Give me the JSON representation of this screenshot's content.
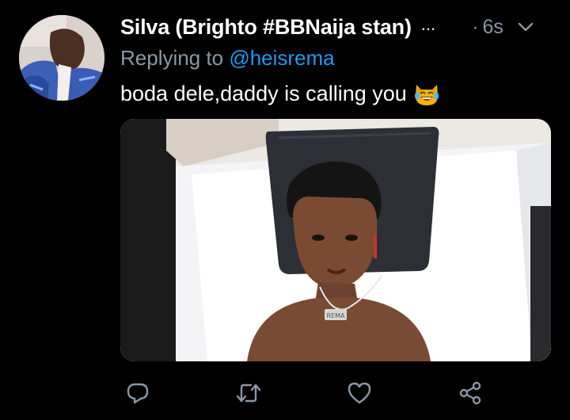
{
  "tweet": {
    "display_name": "Silva (Brighto #BBNaija stan)",
    "overflow_marker": "...",
    "timestamp_dot": "·",
    "timestamp": "6s",
    "reply_prefix": "Replying to",
    "reply_handle": "@heisrema",
    "text": "boda dele,daddy is calling you",
    "emoji": "cat-face-tears-of-joy",
    "media": {
      "kind": "photo",
      "pendant_text": "REMA"
    }
  },
  "actions": {
    "reply_icon": "reply-bubble-icon",
    "retweet_icon": "retweet-icon",
    "like_icon": "heart-icon",
    "share_icon": "share-icon"
  },
  "colors": {
    "background": "#000000",
    "primary_text": "#ffffff",
    "secondary_text": "#8b98a5",
    "link": "#1d9bf0",
    "icon": "#8b98a5"
  }
}
